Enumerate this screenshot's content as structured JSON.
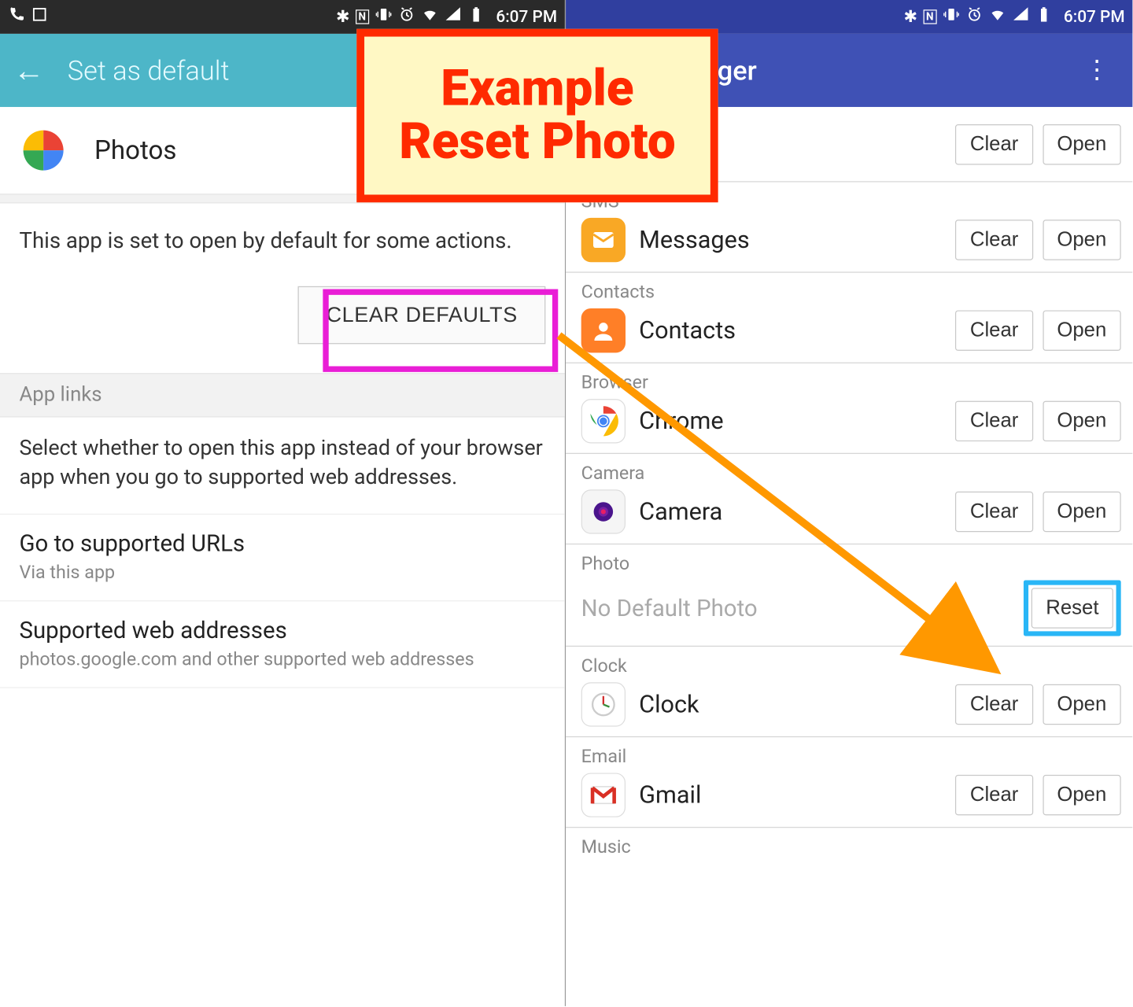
{
  "status": {
    "time": "6:07 PM"
  },
  "left": {
    "title": "Set as default",
    "app_name": "Photos",
    "default_desc": "This app is set to open by default for some actions.",
    "clear_defaults": "CLEAR DEFAULTS",
    "applinks_label": "App links",
    "applinks_desc": "Select whether to open this app instead of your browser app when you go to supported web addresses.",
    "row1_title": "Go to supported URLs",
    "row1_sub": "Via this app",
    "row2_title": "Supported web addresses",
    "row2_sub": "photos.google.com and other supported web addresses"
  },
  "right": {
    "title": "t App Manager",
    "btn_clear": "Clear",
    "btn_open": "Open",
    "btn_reset": "Reset",
    "items": [
      {
        "cat": "SMS",
        "name": "Messages"
      },
      {
        "cat": "Contacts",
        "name": "Contacts"
      },
      {
        "cat": "Browser",
        "name": "Chrome"
      },
      {
        "cat": "Camera",
        "name": "Camera"
      },
      {
        "cat": "Photo",
        "placeholder": "No Default Photo"
      },
      {
        "cat": "Clock",
        "name": "Clock"
      },
      {
        "cat": "Email",
        "name": "Gmail"
      },
      {
        "cat": "Music",
        "name": ""
      }
    ]
  },
  "annotation": {
    "line1": "Example",
    "line2": "Reset Photo"
  }
}
